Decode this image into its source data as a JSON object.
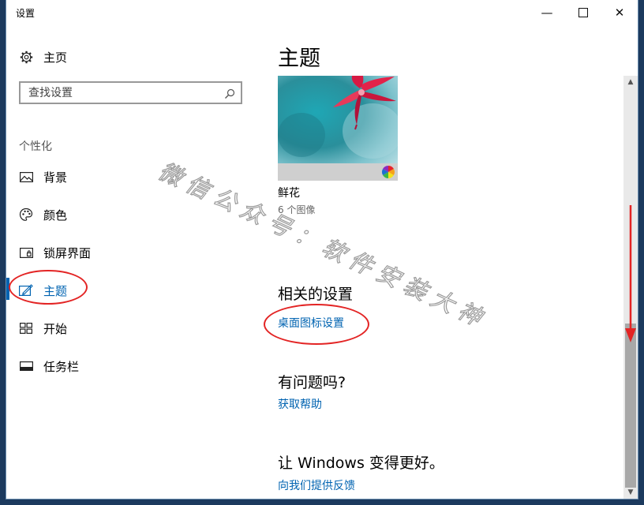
{
  "window": {
    "title": "设置",
    "controls": {
      "minimize": "—",
      "close": "✕"
    }
  },
  "sidebar": {
    "home": {
      "label": "主页",
      "icon": "gear-icon"
    },
    "search": {
      "placeholder": "查找设置",
      "icon": "search-icon"
    },
    "section_title": "个性化",
    "items": [
      {
        "label": "背景",
        "icon": "picture-icon"
      },
      {
        "label": "颜色",
        "icon": "palette-icon"
      },
      {
        "label": "锁屏界面",
        "icon": "lock-screen-icon"
      },
      {
        "label": "主题",
        "icon": "theme-brush-icon",
        "selected": true
      },
      {
        "label": "开始",
        "icon": "start-tiles-icon"
      },
      {
        "label": "任务栏",
        "icon": "taskbar-icon"
      }
    ]
  },
  "main": {
    "title": "主题",
    "theme": {
      "name": "鲜花",
      "count": "6 个图像"
    },
    "related": {
      "heading": "相关的设置",
      "desktop_icon_link": "桌面图标设置"
    },
    "help": {
      "heading": "有问题吗?",
      "get_help_link": "获取帮助"
    },
    "feedback": {
      "heading": "让 Windows 变得更好。",
      "feedback_link": "向我们提供反馈"
    }
  },
  "watermark": "微信公众号：软件安装大神",
  "colors": {
    "accent": "#0063b1",
    "annotation": "#e32424",
    "desktop": "#1c3a5e"
  }
}
